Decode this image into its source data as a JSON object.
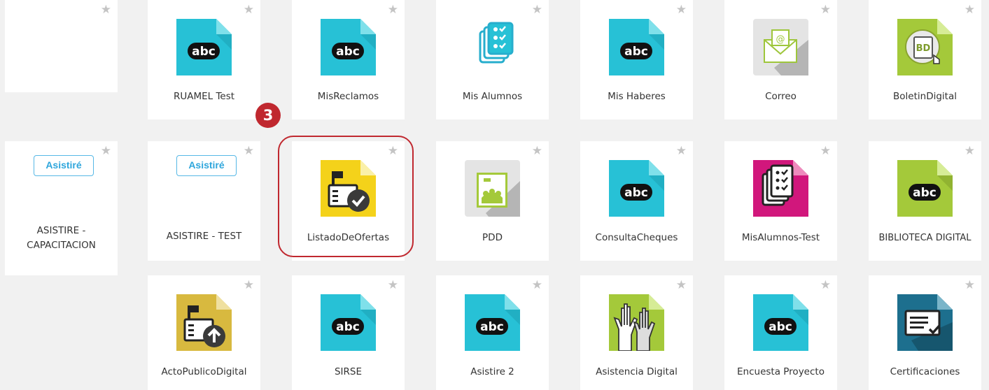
{
  "star_glyph": "★",
  "step_marker": "3",
  "colors": {
    "teal_doc": "#27c1d6",
    "yellow_doc": "#f4d21a",
    "lime_doc": "#a4c93a",
    "magenta_doc": "#d1177c",
    "highlight": "#c0282f"
  },
  "apps": [
    {
      "label": "",
      "icon": "blank"
    },
    {
      "label": "RUAMEL Test",
      "icon": "abc-doc-icon"
    },
    {
      "label": "MisReclamos",
      "icon": "abc-doc-icon"
    },
    {
      "label": "Mis Alumnos",
      "icon": "student-list-icon"
    },
    {
      "label": "Mis Haberes",
      "icon": "abc-doc-icon"
    },
    {
      "label": "Correo",
      "icon": "mail-icon"
    },
    {
      "label": "BoletinDigital",
      "icon": "bulletin-icon"
    },
    {
      "label": "ASISTIRE - CAPACITACION",
      "icon": "asistire-badge",
      "badge": "Asistiré"
    },
    {
      "label": "ASISTIRE - TEST",
      "icon": "asistire-badge",
      "badge": "Asistiré"
    },
    {
      "label": "ListadoDeOfertas",
      "icon": "offer-list-icon"
    },
    {
      "label": "PDD",
      "icon": "pdd-icon"
    },
    {
      "label": "ConsultaCheques",
      "icon": "abc-doc-icon"
    },
    {
      "label": "MisAlumnos-Test",
      "icon": "student-list-icon"
    },
    {
      "label": "BIBLIOTECA DIGITAL",
      "icon": "abc-doc-icon"
    },
    {
      "label": "ActoPublicoDigital",
      "icon": "upload-id-icon"
    },
    {
      "label": "SIRSE",
      "icon": "abc-doc-icon"
    },
    {
      "label": "Asistire 2",
      "icon": "abc-doc-icon"
    },
    {
      "label": "Asistencia Digital",
      "icon": "raised-hands-icon"
    },
    {
      "label": "Encuesta Proyecto",
      "icon": "abc-doc-icon"
    },
    {
      "label": "Certificaciones",
      "icon": "certificate-icon"
    }
  ]
}
